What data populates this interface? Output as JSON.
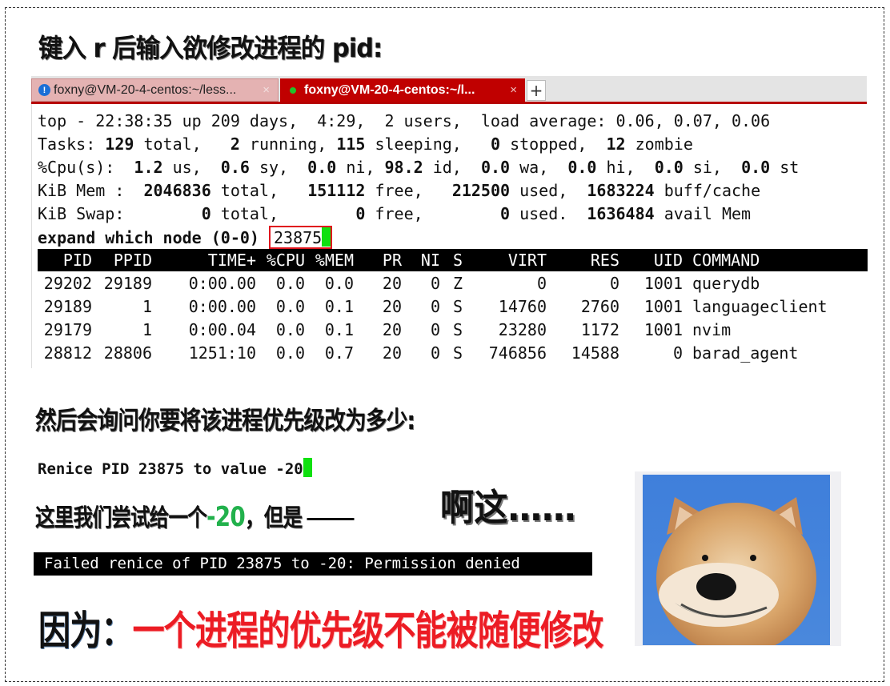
{
  "headings": {
    "step1": "键入 r 后输入欲修改进程的 pid:",
    "step2": "然后会询问你要将该进程优先级改为多少:",
    "step3_prefix": "这里我们尝试给一个",
    "step3_value": "-20",
    "step3_suffix": "，但是",
    "reaction": "啊这……",
    "conclusion_prefix": "因为：",
    "conclusion_text": "一个进程的优先级不能被随便修改"
  },
  "terminal": {
    "tabs": [
      {
        "title": "foxny@VM-20-4-centos:~/less...",
        "icon": "info-icon",
        "active": false,
        "close": "×"
      },
      {
        "title": "foxny@VM-20-4-centos:~/l...",
        "icon": "green-dot-icon",
        "active": true,
        "close": "×"
      }
    ],
    "new_tab_label": "+",
    "summary": {
      "uptime_line": "top - 22:38:35 up 209 days,  4:29,  2 users,  load average: 0.06, 0.07, 0.06",
      "tasks": {
        "label": "Tasks:",
        "total": "129",
        "running": "2",
        "sleeping": "115",
        "stopped": "0",
        "zombie": "12"
      },
      "cpu": {
        "label": "%Cpu(s):",
        "us": "1.2",
        "sy": "0.6",
        "ni": "0.0",
        "id": "98.2",
        "wa": "0.0",
        "hi": "0.0",
        "si": "0.0",
        "st": "0.0"
      },
      "mem": {
        "label": "KiB Mem :",
        "total": "2046836",
        "free": "151112",
        "used": "212500",
        "buff_cache": "1683224"
      },
      "swap": {
        "label": "KiB Swap:",
        "total": "0",
        "free": "0",
        "used": "0",
        "avail_mem": "1636484"
      }
    },
    "prompt": {
      "label": "expand which node (0-0)",
      "value": "23875"
    },
    "columns": [
      "PID",
      "PPID",
      "TIME+",
      "%CPU",
      "%MEM",
      "PR",
      "NI",
      "S",
      "VIRT",
      "RES",
      "UID",
      "COMMAND"
    ],
    "rows": [
      [
        "29202",
        "29189",
        "0:00.00",
        "0.0",
        "0.0",
        "20",
        "0",
        "Z",
        "0",
        "0",
        "1001",
        "querydb"
      ],
      [
        "29189",
        "1",
        "0:00.00",
        "0.0",
        "0.1",
        "20",
        "0",
        "S",
        "14760",
        "2760",
        "1001",
        "languageclient"
      ],
      [
        "29179",
        "1",
        "0:00.04",
        "0.0",
        "0.1",
        "20",
        "0",
        "S",
        "23280",
        "1172",
        "1001",
        "nvim"
      ],
      [
        "28812",
        "28806",
        "1251:10",
        "0.0",
        "0.7",
        "20",
        "0",
        "S",
        "746856",
        "14588",
        "0",
        "barad_agent"
      ]
    ]
  },
  "renice_prompt": "Renice PID 23875 to value -20",
  "error_message": "Failed renice of PID 23875 to -20: Permission denied",
  "meme_image": "smiling-shiba-dog",
  "colors": {
    "accent_red": "#c00000",
    "highlight_green": "#22b14c",
    "conclusion_red": "#ec1c24",
    "cursor_green": "#0fe00f"
  }
}
